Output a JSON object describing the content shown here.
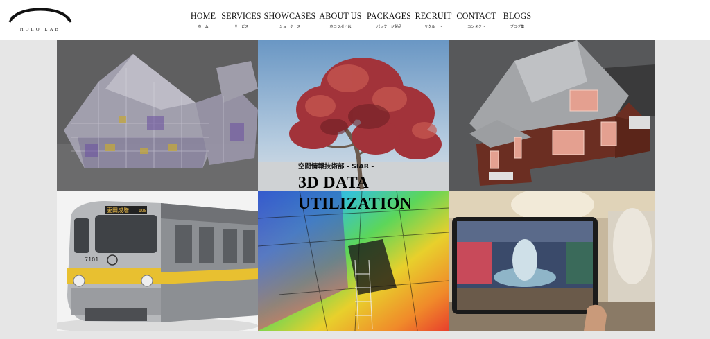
{
  "brand": {
    "logo_text": "HOLO LAB"
  },
  "nav": [
    {
      "label": "HOME",
      "sub": "ホーム"
    },
    {
      "label": "SERVICES",
      "sub": "サービス"
    },
    {
      "label": "SHOWCASES",
      "sub": "ショーケース"
    },
    {
      "label": "ABOUT US",
      "sub": "ホロラボとは"
    },
    {
      "label": "PACKAGES",
      "sub": "パッケージ製品"
    },
    {
      "label": "RECRUIT",
      "sub": "リクルート"
    },
    {
      "label": "CONTACT",
      "sub": "コンタクト"
    },
    {
      "label": "BLOGS",
      "sub": "ブログ集"
    }
  ],
  "hero": {
    "subtitle": "空間情報技術部 - SIAR -",
    "title_line1": "3D DATA",
    "title_line2": "UTILIZATION"
  },
  "train": {
    "destination": "妻田成増",
    "number_top": "195",
    "number_front": "7101"
  },
  "colors": {
    "header_bg": "#ffffff",
    "stage_bg": "#e6e6e6",
    "text": "#111111",
    "dark_tile": "#5a5a5a",
    "brick": "#6b2e22",
    "train_stripe": "#e8c030"
  }
}
